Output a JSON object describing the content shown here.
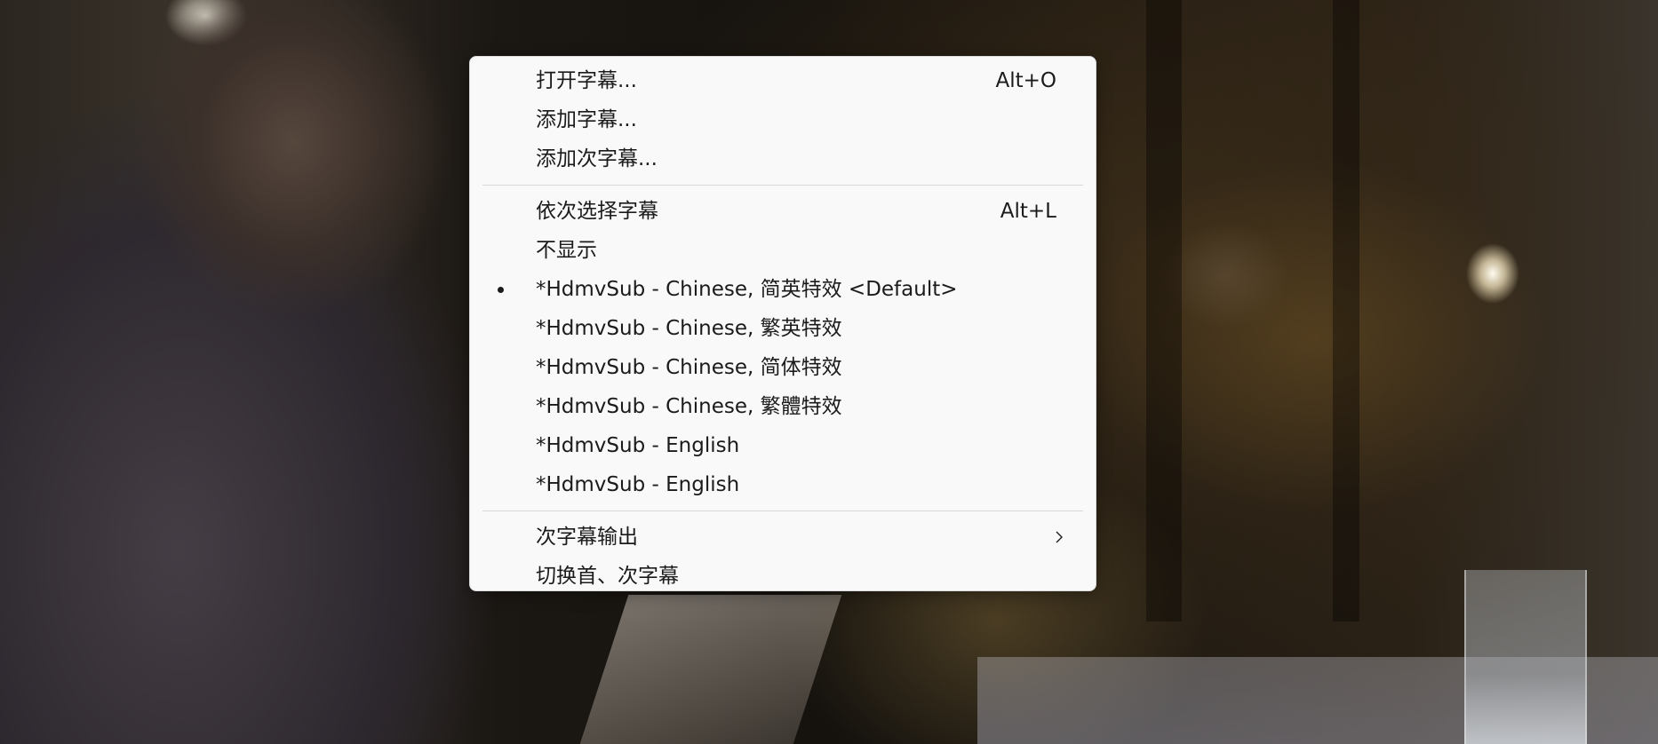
{
  "menu": {
    "section1": [
      {
        "label": "打开字幕...",
        "shortcut": "Alt+O"
      },
      {
        "label": "添加字幕...",
        "shortcut": ""
      },
      {
        "label": "添加次字幕...",
        "shortcut": ""
      }
    ],
    "section2": [
      {
        "label": "依次选择字幕",
        "shortcut": "Alt+L"
      },
      {
        "label": "不显示",
        "shortcut": ""
      },
      {
        "label": "*HdmvSub - Chinese, 简英特效 <Default>",
        "shortcut": "",
        "selected": true
      },
      {
        "label": "*HdmvSub - Chinese, 繁英特效",
        "shortcut": ""
      },
      {
        "label": "*HdmvSub - Chinese, 简体特效",
        "shortcut": ""
      },
      {
        "label": "*HdmvSub - Chinese, 繁體特效",
        "shortcut": ""
      },
      {
        "label": "*HdmvSub - English",
        "shortcut": ""
      },
      {
        "label": "*HdmvSub - English",
        "shortcut": ""
      }
    ],
    "section3": [
      {
        "label": "次字幕输出",
        "has_submenu": true
      },
      {
        "label": "切换首、次字幕"
      }
    ]
  },
  "icons": {
    "selected_marker": "bullet-icon",
    "submenu_arrow": "chevron-right-icon"
  },
  "colors": {
    "menu_background": "#f9f9f9",
    "menu_text": "#1b1b1b",
    "separator": "#d8d8d8"
  }
}
